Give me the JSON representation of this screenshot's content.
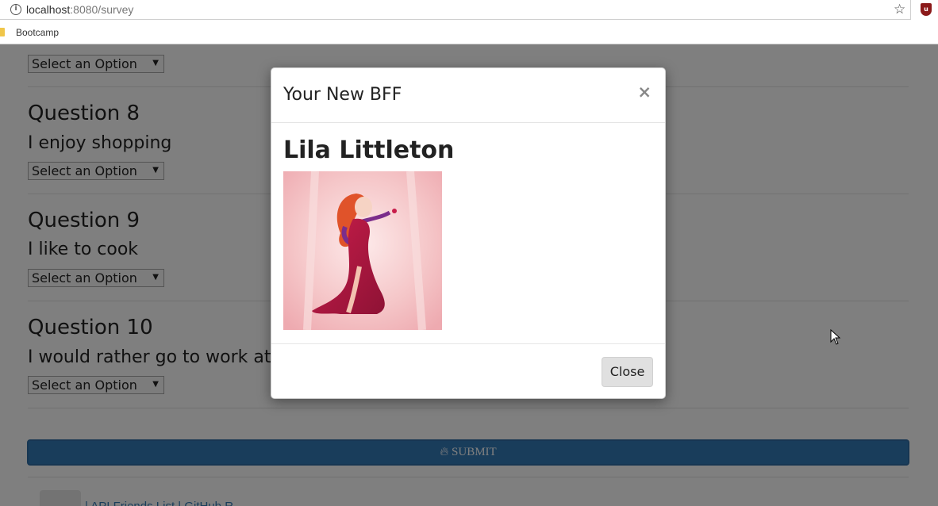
{
  "browser": {
    "url_host": "localhost",
    "url_rest": ":8080/survey",
    "bookmark": "Bootcamp",
    "extension_label": "u"
  },
  "survey": {
    "select_placeholder": "Select an Option",
    "questions": [
      {
        "title": "Question 8",
        "text": "I enjoy shopping"
      },
      {
        "title": "Question 9",
        "text": "I like to cook"
      },
      {
        "title": "Question 10",
        "text": "I would rather go to work at"
      }
    ],
    "submit_label": "SUBMIT",
    "footer_links": "| API Friends List | GitHub R"
  },
  "modal": {
    "title": "Your New BFF",
    "close_symbol": "×",
    "friend_name": "Lila Littleton",
    "close_button": "Close"
  },
  "colors": {
    "submit": "#337ab7",
    "backdrop": "rgba(0,0,0,0.5)"
  }
}
